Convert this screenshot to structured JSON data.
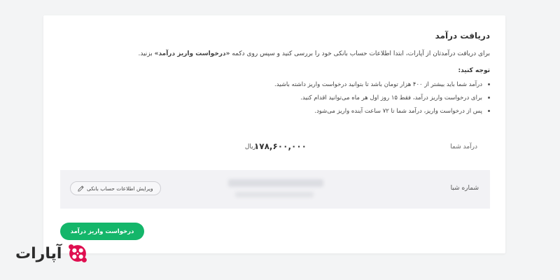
{
  "card": {
    "title": "دریافت درآمد",
    "intro_prefix": "برای دریافت درآمدتان از آپارات، ابتدا اطلاعات حساب بانکی خود را بررسی کنید و سپس روی دکمه",
    "intro_button_ref": "«درخواست واریز درآمد»",
    "intro_suffix": "بزنید.",
    "note_title": "توجه کنید:",
    "notes": [
      "درآمد شما باید بیشتر از ۴۰۰ هزار تومان باشد تا بتوانید درخواست واریز داشته باشید.",
      "برای درخواست واریز درآمد، فقط ۱۵ روز اول هر ماه می‌توانید اقدام کنید.",
      "پس از درخواست واریز، درآمد شما تا ۷۲ ساعت آینده واریز می‌شود."
    ],
    "income_label": "درآمد شما",
    "income_value": "۱۷۸,۶۰۰,۰۰۰",
    "income_unit": "ریال",
    "sheba_label": "شماره شبا",
    "edit_button": "ویرایش اطلاعات حساب بانکی",
    "request_button": "درخواست واریز درآمد"
  },
  "brand": {
    "name": "آپارات",
    "logo_color": "#df0f50"
  },
  "colors": {
    "accent": "#14b66a",
    "background": "#f3f4f5"
  }
}
